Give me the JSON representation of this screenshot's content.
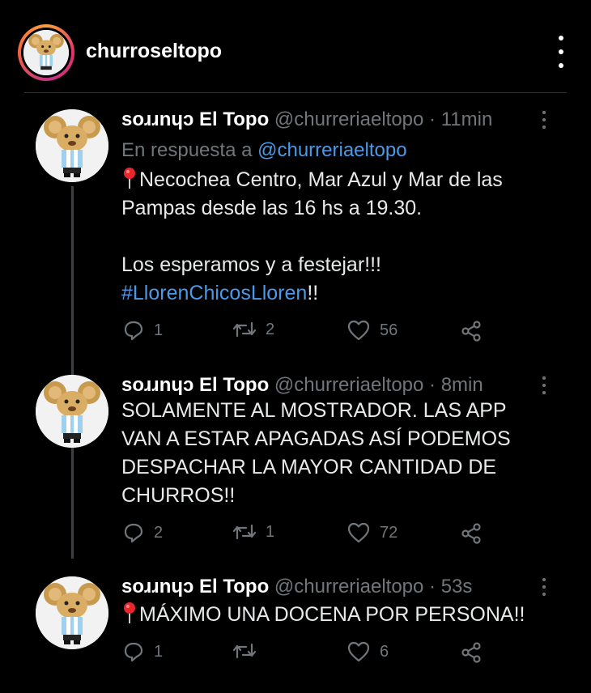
{
  "story": {
    "username": "churroseltopo"
  },
  "tweets": [
    {
      "display_name": "soɹɹnɥɔ El Topo",
      "handle": "@churreriaeltopo",
      "sep": "·",
      "time": "11min",
      "reply_prefix": "En respuesta a",
      "reply_to": "@churreriaeltopo",
      "line1": "Necochea Centro, Mar Azul y Mar de las",
      "line2": "Pampas desde las 16 hs a 19.30.",
      "line3": "Los esperamos y a festejar!!!",
      "hashtag": "#LlorenChicosLloren",
      "hashtag_suffix": "!!",
      "replies": "1",
      "retweets": "2",
      "likes": "56"
    },
    {
      "display_name": "soɹɹnɥɔ El Topo",
      "handle": "@churreriaeltopo",
      "sep": "·",
      "time": "8min",
      "line1": "SOLAMENTE AL MOSTRADOR. LAS APP",
      "line2": "VAN A ESTAR APAGADAS ASÍ PODEMOS",
      "line3": "DESPACHAR LA MAYOR CANTIDAD DE",
      "line4": "CHURROS!!",
      "replies": "2",
      "retweets": "1",
      "likes": "72"
    },
    {
      "display_name": "soɹɹnɥɔ El Topo",
      "handle": "@churreriaeltopo",
      "sep": "·",
      "time": "53s",
      "line1": "MÁXIMO UNA DOCENA POR PERSONA!!",
      "replies": "1",
      "retweets": "",
      "likes": "6"
    }
  ],
  "icons": {
    "pin": "pin-icon",
    "reply": "reply-icon",
    "retweet": "retweet-icon",
    "like": "heart-icon",
    "share": "share-icon",
    "more": "more-vertical-icon"
  },
  "colors": {
    "background": "#000000",
    "text": "#e7e9ea",
    "muted": "#71767b",
    "link": "#4a9ae9",
    "pin": "#e8262b"
  }
}
